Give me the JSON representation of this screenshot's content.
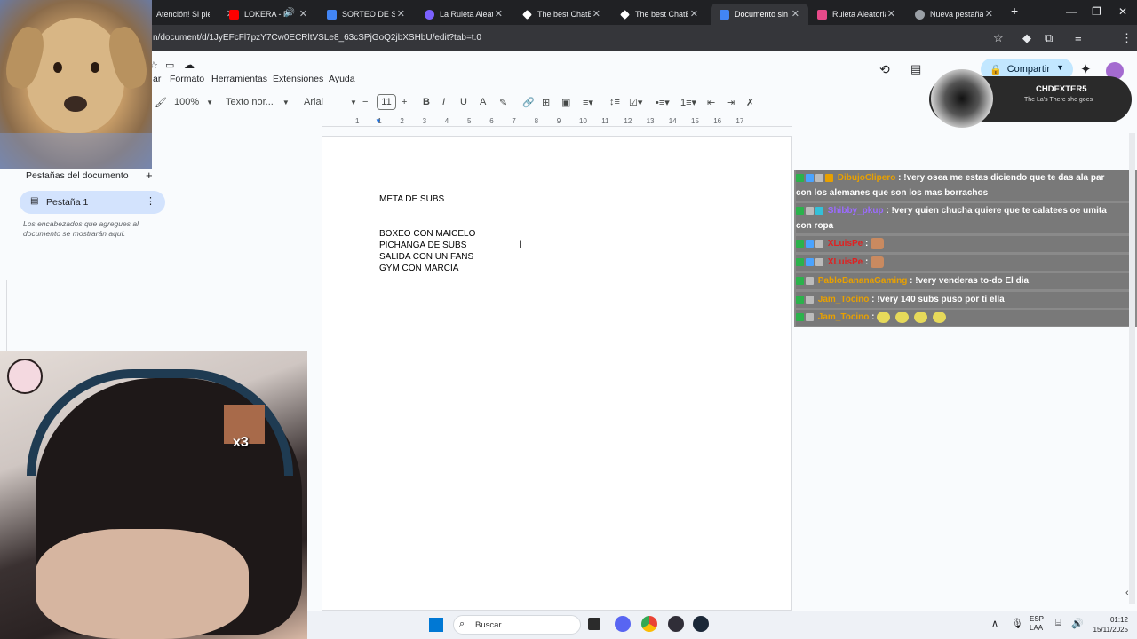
{
  "browser": {
    "tabs": [
      {
        "label": "Atención! Si pien",
        "color": "#e8a000"
      },
      {
        "label": "LOKERA - Ra",
        "color": "#ff0000"
      },
      {
        "label": "SORTEO DE SUBS",
        "color": "#4285f4"
      },
      {
        "label": "La Ruleta Aleatori",
        "color": "#7b61ff"
      },
      {
        "label": "The best ChatBot",
        "color": "#ffffff"
      },
      {
        "label": "The best ChatBot",
        "color": "#ffffff"
      },
      {
        "label": "Documento sin tít",
        "color": "#4285f4"
      },
      {
        "label": "Ruleta Aleatoria",
        "color": "#e84a8a"
      },
      {
        "label": "Nueva pestaña",
        "color": "#9aa0a6"
      }
    ],
    "url": "n/document/d/1JyEFcFl7pzY7Cw0ECRltVSLe8_63cSPjGoQ2jbXSHbU/edit?tab=t.0"
  },
  "docs": {
    "menu": [
      "ar",
      "Formato",
      "Herramientas",
      "Extensiones",
      "Ayuda"
    ],
    "zoom": "100%",
    "style": "Texto nor...",
    "font": "Arial",
    "font_size": "11",
    "share_label": "Compartir"
  },
  "sidebar": {
    "title": "Pestañas del documento",
    "tab_label": "Pestaña 1",
    "hint": "Los encabezados que agregues al documento se mostrarán aquí."
  },
  "document": {
    "lines": [
      "META DE SUBS",
      "BOXEO CON MAICELO",
      "PICHANGA DE SUBS",
      "SALIDA CON UN FANS",
      "GYM CON MARCIA"
    ]
  },
  "ruler": {
    "ticks": [
      "1",
      "1",
      "2",
      "3",
      "4",
      "5",
      "6",
      "7",
      "8",
      "9",
      "10",
      "11",
      "12",
      "13",
      "14",
      "15",
      "16",
      "17"
    ]
  },
  "overlay": {
    "music_name": "CHDEXTER5",
    "music_song": "The La's There she goes",
    "emote_multiplier": "x3"
  },
  "chat": [
    {
      "user": "DibujoClipero",
      "user_color": "#e8a000",
      "text": ": !very osea me estas diciendo que te das ala par",
      "cont": "con los alemanes que son los mas borrachos"
    },
    {
      "user": "Shibby_pkup",
      "user_color": "#9b6bff",
      "text": ": !very quien chucha quiere que te calatees oe umita",
      "cont": "con ropa"
    },
    {
      "user": "XLuisPe",
      "user_color": "#e02020",
      "text": ":",
      "cont": ""
    },
    {
      "user": "XLuisPe",
      "user_color": "#e02020",
      "text": ":",
      "cont": ""
    },
    {
      "user": "PabloBananaGaming",
      "user_color": "#e8a000",
      "text": ": !very venderas to-do El dia",
      "cont": ""
    },
    {
      "user": "Jam_Tocino",
      "user_color": "#e8a000",
      "text": ": !very 140 subs puso por ti ella",
      "cont": ""
    },
    {
      "user": "Jam_Tocino",
      "user_color": "#e8a000",
      "text": ":",
      "cont": ""
    }
  ],
  "taskbar": {
    "search_placeholder": "Buscar",
    "lang_top": "ESP",
    "lang_bottom": "LAA",
    "time": "01:12",
    "date": "15/11/2025"
  }
}
